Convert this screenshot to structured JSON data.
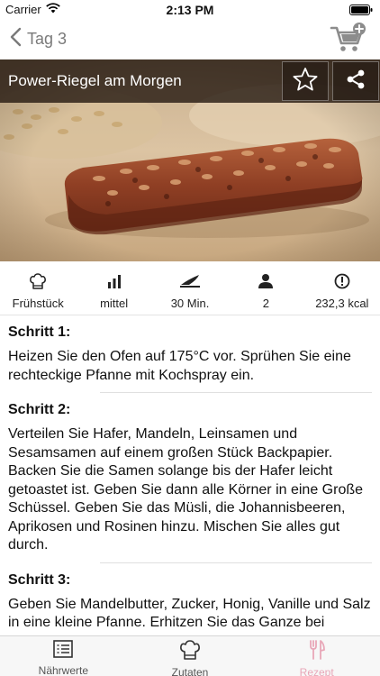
{
  "status_bar": {
    "carrier": "Carrier",
    "time": "2:13 PM",
    "wifi_icon": "wifi-icon",
    "battery_icon": "battery-icon"
  },
  "nav": {
    "back_label": "Tag 3",
    "back_icon": "chevron-left-icon",
    "cart_icon": "cart-add-icon"
  },
  "recipe": {
    "title": "Power-Riegel am Morgen",
    "favorite_icon": "star-icon",
    "share_icon": "share-icon"
  },
  "info": [
    {
      "icon": "chef-hat-icon",
      "label": "Frühstück"
    },
    {
      "icon": "difficulty-bars-icon",
      "label": "mittel"
    },
    {
      "icon": "knife-icon",
      "label": "30 Min."
    },
    {
      "icon": "person-icon",
      "label": "2"
    },
    {
      "icon": "alert-circle-icon",
      "label": "232,3 kcal"
    }
  ],
  "steps": [
    {
      "title": "Schritt 1:",
      "text": "Heizen Sie den Ofen auf 175°C vor. Sprühen Sie eine rechteckige Pfanne mit Kochspray ein."
    },
    {
      "title": "Schritt 2:",
      "text": "Verteilen Sie Hafer, Mandeln, Leinsamen und Sesamsamen auf einem großen Stück Backpapier. Backen Sie die Samen solange bis der Hafer leicht getoastet ist. Geben Sie dann alle Körner in eine Große Schüssel. Geben Sie das Müsli, die Johannisbeeren, Aprikosen und Rosinen hinzu. Mischen Sie alles gut durch."
    },
    {
      "title": "Schritt 3:",
      "text": "Geben Sie Mandelbutter, Zucker, Honig, Vanille und Salz in eine kleine Pfanne. Erhitzen Sie das Ganze bei"
    }
  ],
  "tabs": [
    {
      "label": "Nährwerte",
      "icon": "list-icon",
      "active": false
    },
    {
      "label": "Zutaten",
      "icon": "chef-hat-icon",
      "active": false
    },
    {
      "label": "Rezept",
      "icon": "fork-knife-icon",
      "active": true
    }
  ],
  "colors": {
    "accent_pink": "#e8a7b8",
    "title_bar": "#2a1c14",
    "nav_gray": "#7a7a7a"
  }
}
